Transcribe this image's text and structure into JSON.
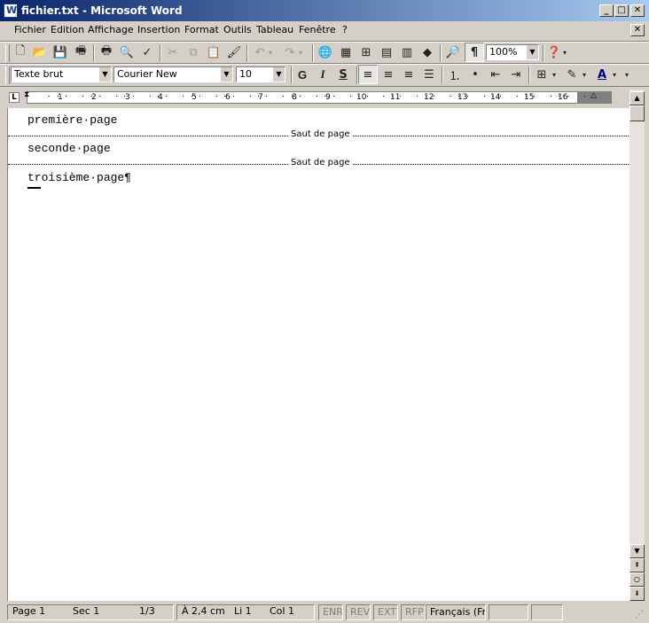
{
  "window": {
    "title": "fichier.txt - Microsoft Word"
  },
  "menubar": {
    "items": [
      "Fichier",
      "Edition",
      "Affichage",
      "Insertion",
      "Format",
      "Outils",
      "Tableau",
      "Fenêtre",
      "?"
    ]
  },
  "toolbar": {
    "zoom": "100%",
    "style": "Texte brut",
    "font": "Courier New",
    "size": "10",
    "bold": "G",
    "italic": "I",
    "underline": "S"
  },
  "ruler": {
    "ticks": [
      "1",
      "2",
      "3",
      "4",
      "5",
      "6",
      "7",
      "8",
      "9",
      "10",
      "11",
      "12",
      "13",
      "14",
      "15",
      "16"
    ]
  },
  "document": {
    "lines": [
      "première·page",
      "seconde·page",
      "troisième·page¶"
    ],
    "page_break_label": "Saut de page"
  },
  "statusbar": {
    "page": "Page 1",
    "section": "Sec 1",
    "page_count": "1/3",
    "position": "À 2,4 cm",
    "line": "Li 1",
    "column": "Col 1",
    "modes": [
      "ENR",
      "REV",
      "EXT",
      "RFP"
    ],
    "language": "Français (Fr"
  },
  "icons": [
    "new-icon",
    "open-icon",
    "save-icon",
    "permission-icon",
    "print-icon",
    "print-preview-icon",
    "spelling-icon",
    "cut-icon",
    "copy-icon",
    "paste-icon",
    "format-painter-icon",
    "undo-icon",
    "redo-icon",
    "hyperlink-icon",
    "tables-borders-icon",
    "insert-table-icon",
    "insert-excel-icon",
    "columns-icon",
    "drawing-icon",
    "document-map-icon",
    "show-formatting-icon",
    "help-icon"
  ]
}
